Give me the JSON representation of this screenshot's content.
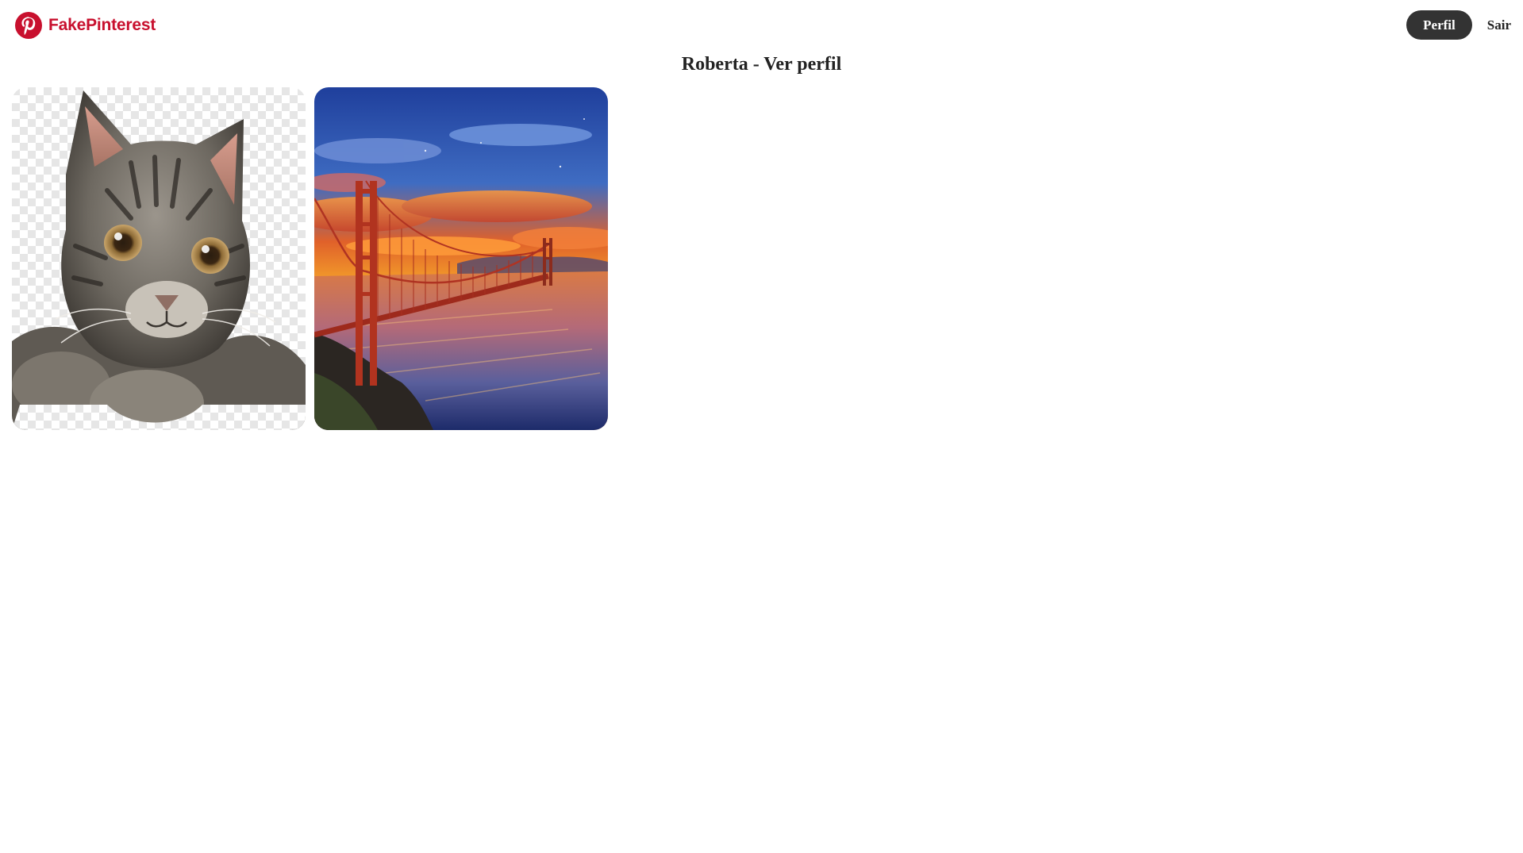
{
  "header": {
    "brand_name": "FakePinterest",
    "brand_icon": "pinterest-logo-icon",
    "brand_color": "#c8102e",
    "nav": {
      "profile_label": "Perfil",
      "logout_label": "Sair"
    }
  },
  "main": {
    "title": "Roberta - Ver perfil",
    "pins": [
      {
        "image": "tabby-kitten-photo"
      },
      {
        "image": "golden-gate-bridge-sunset-photo"
      }
    ]
  },
  "colors": {
    "background": "#ffffff",
    "profile_button": "#333333",
    "profile_button_text": "#ffffff",
    "text": "#222222"
  }
}
